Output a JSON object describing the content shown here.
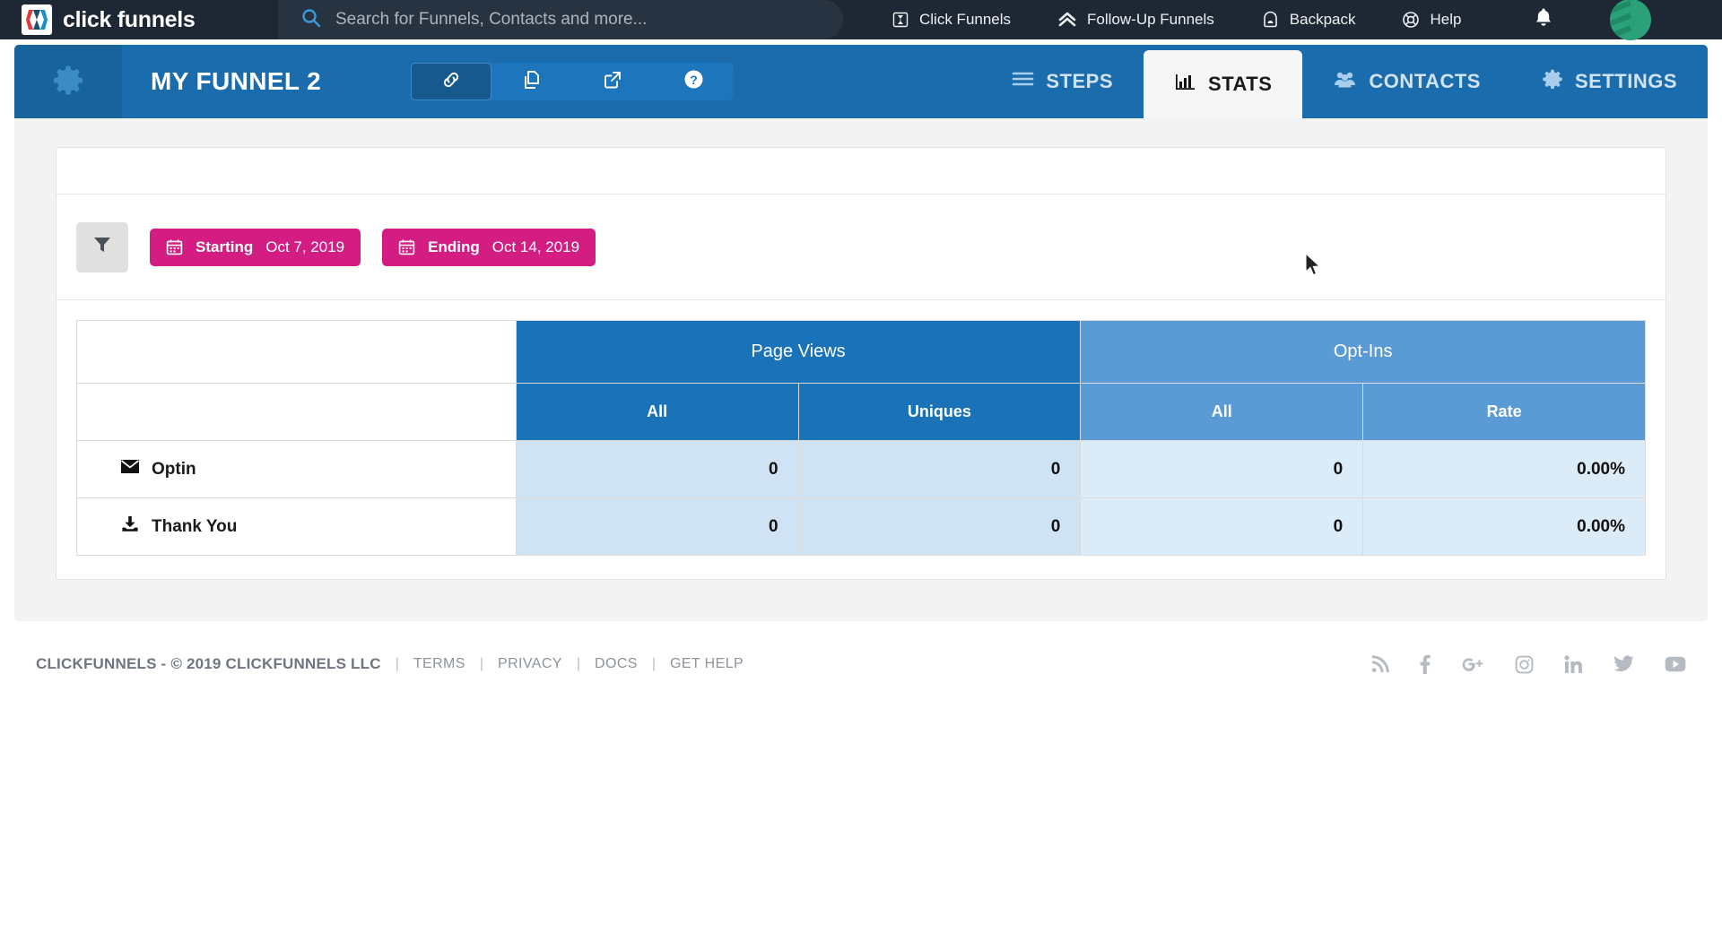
{
  "topnav": {
    "brand_name": "click funnels",
    "brand_logo_icon": "clickfunnels-logo-icon",
    "search": {
      "placeholder": "Search for Funnels, Contacts and more...",
      "value": "",
      "icon": "search-icon"
    },
    "items": [
      {
        "label": "Click Funnels",
        "icon": "clickfunnels-icon"
      },
      {
        "label": "Follow-Up Funnels",
        "icon": "chevron-up-double-icon"
      },
      {
        "label": "Backpack",
        "icon": "backpack-icon"
      },
      {
        "label": "Help",
        "icon": "lifebuoy-icon"
      }
    ],
    "notifications_icon": "bell-icon",
    "avatar_icon": "avatar",
    "avatar_color": "#2aa179"
  },
  "funnel_header": {
    "gear_icon": "gear-icon",
    "title": "MY FUNNEL 2",
    "icon_buttons": [
      {
        "name": "link-icon",
        "active": true
      },
      {
        "name": "copy-icon",
        "active": false
      },
      {
        "name": "external-link-icon",
        "active": false
      },
      {
        "name": "question-circle-icon",
        "active": false
      }
    ],
    "tabs": [
      {
        "label": "STEPS",
        "icon": "hamburger-icon",
        "active": false
      },
      {
        "label": "STATS",
        "icon": "bar-chart-icon",
        "active": true
      },
      {
        "label": "CONTACTS",
        "icon": "users-icon",
        "active": false
      },
      {
        "label": "SETTINGS",
        "icon": "gear-icon",
        "active": false
      }
    ],
    "bar_color": "#1b6cac"
  },
  "filters": {
    "filter_icon": "funnel-filter-icon",
    "starting": {
      "icon": "calendar-icon",
      "label": "Starting",
      "value": "Oct 7, 2019"
    },
    "ending": {
      "icon": "calendar-icon",
      "label": "Ending",
      "value": "Oct 14, 2019"
    },
    "pill_color": "#d31d83"
  },
  "chart_data": {
    "type": "table",
    "title": "",
    "group_headers": [
      {
        "label": "",
        "span": 1
      },
      {
        "label": "Page Views",
        "span": 2,
        "color": "#1a72b8"
      },
      {
        "label": "Opt-Ins",
        "span": 2,
        "color": "#5b9bd5"
      }
    ],
    "columns": [
      "",
      "All",
      "Uniques",
      "All",
      "Rate"
    ],
    "rows": [
      {
        "name": "Optin",
        "icon": "envelope-icon",
        "values": [
          "0",
          "0",
          "0",
          "0.00%"
        ]
      },
      {
        "name": "Thank You",
        "icon": "download-icon",
        "values": [
          "0",
          "0",
          "0",
          "0.00%"
        ]
      }
    ]
  },
  "footer": {
    "copyright": "CLICKFUNNELS - © 2019 CLICKFUNNELS LLC",
    "separator": "|",
    "links": [
      "TERMS",
      "PRIVACY",
      "DOCS",
      "GET HELP"
    ],
    "social": [
      "rss-icon",
      "facebook-icon",
      "google-plus-icon",
      "instagram-icon",
      "linkedin-icon",
      "twitter-icon",
      "youtube-icon"
    ]
  }
}
